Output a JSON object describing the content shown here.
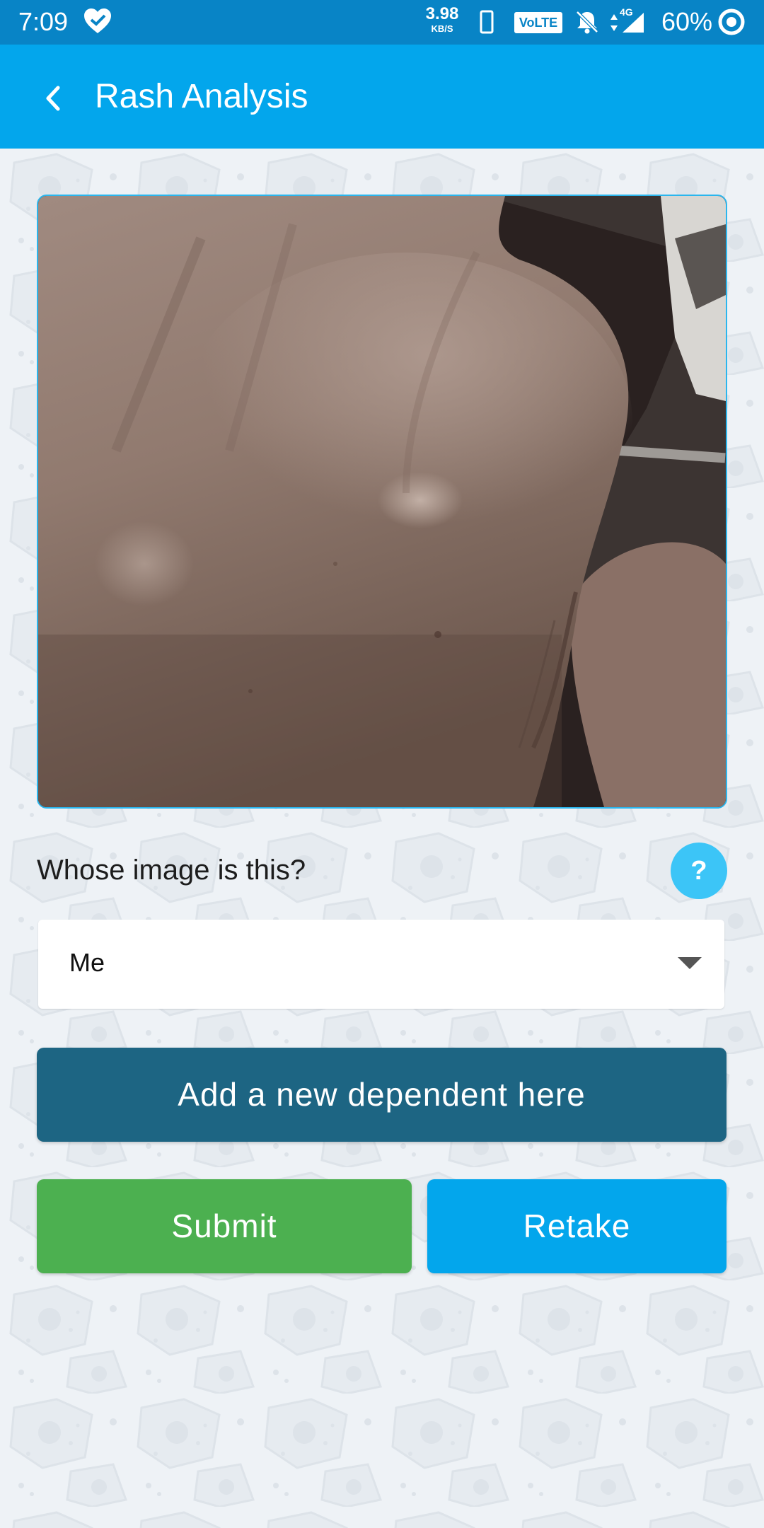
{
  "status_bar": {
    "time": "7:09",
    "network_speed_value": "3.98",
    "network_speed_unit": "KB/S",
    "volte_label": "VoLTE",
    "network_type": "4G",
    "battery_percent": "60%",
    "icons": [
      "heart-check-icon",
      "phone-outline-icon",
      "bell-off-icon",
      "data-arrows-icon",
      "signal-icon",
      "battery-ring-icon"
    ]
  },
  "app_bar": {
    "title": "Rash Analysis",
    "back_icon": "chevron-left-icon"
  },
  "photo": {
    "subject": "skin-photo"
  },
  "form": {
    "question": "Whose image is this?",
    "help_label": "?",
    "select_value": "Me",
    "select_icon": "caret-down-icon"
  },
  "buttons": {
    "add_dependent": "Add a new dependent here",
    "submit": "Submit",
    "retake": "Retake"
  },
  "colors": {
    "status_bar": "#0884c6",
    "app_bar": "#03a6ec",
    "dependent_button": "#1d6583",
    "submit_button": "#4cb050",
    "retake_button": "#03a6ec",
    "help_button": "#3cc5f7",
    "background": "#eef2f6"
  }
}
